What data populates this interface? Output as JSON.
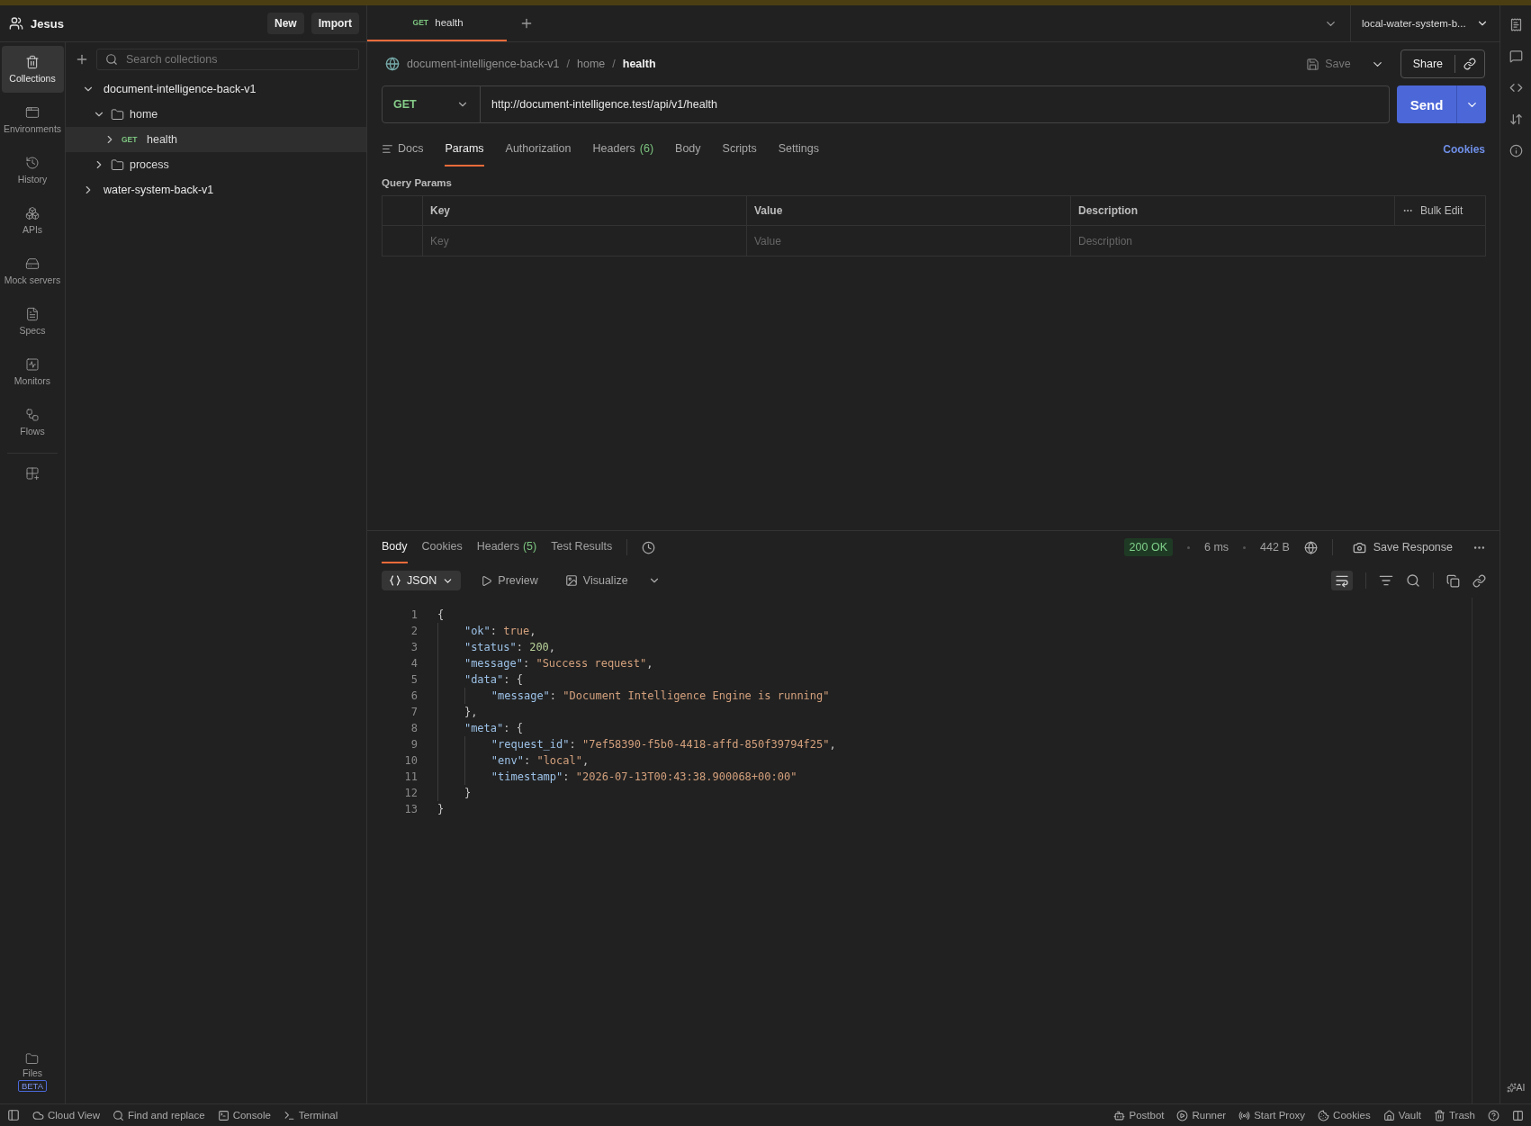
{
  "top_bar": {
    "user": "Jesus",
    "buttons": [
      "New",
      "Import"
    ]
  },
  "nav_rail": {
    "items": [
      {
        "label": "Collections",
        "selected": true
      },
      {
        "label": "Environments",
        "selected": false
      },
      {
        "label": "History",
        "selected": false
      },
      {
        "label": "APIs",
        "selected": false
      },
      {
        "label": "Mock servers",
        "selected": false
      },
      {
        "label": "Specs",
        "selected": false
      },
      {
        "label": "Monitors",
        "selected": false
      },
      {
        "label": "Flows",
        "selected": false
      }
    ],
    "files": {
      "label": "Files",
      "badge": "BETA"
    }
  },
  "sidebar": {
    "search": {
      "placeholder": "Search collections"
    },
    "tree": [
      {
        "kind": "collection",
        "label": "document-intelligence-back-v1",
        "expanded": true,
        "selected": false,
        "children": [
          {
            "kind": "folder",
            "label": "home",
            "expanded": true,
            "selected": false,
            "children": [
              {
                "kind": "request",
                "method": "GET",
                "label": "health",
                "expanded": false,
                "selected": true
              }
            ]
          },
          {
            "kind": "folder",
            "label": "process",
            "expanded": false,
            "selected": false
          }
        ]
      },
      {
        "kind": "collection",
        "label": "water-system-back-v1",
        "expanded": false,
        "selected": false
      }
    ]
  },
  "tabs": [
    {
      "method": "GET",
      "label": "health",
      "selected": true
    }
  ],
  "environment": "local-water-system-b...",
  "breadcrumb": [
    {
      "kind": "link",
      "text": "document-intelligence-back-v1"
    },
    {
      "kind": "separator",
      "text": "/"
    },
    {
      "kind": "link",
      "text": "home"
    },
    {
      "kind": "separator",
      "text": "/"
    },
    {
      "kind": "current",
      "text": "health"
    }
  ],
  "actions": {
    "save": "Save",
    "share": "Share"
  },
  "request": {
    "method": "GET",
    "url": "http://document-intelligence.test/api/v1/health",
    "send": "Send"
  },
  "request_tabs": [
    {
      "label": "Docs",
      "selected": false
    },
    {
      "label": "Params",
      "selected": true
    },
    {
      "label": "Authorization",
      "selected": false
    },
    {
      "label": "Headers",
      "count": "(6)",
      "selected": false
    },
    {
      "label": "Body",
      "selected": false
    },
    {
      "label": "Scripts",
      "selected": false
    },
    {
      "label": "Settings",
      "selected": false
    }
  ],
  "cookies_link": "Cookies",
  "query_params": {
    "title": "Query Params",
    "columns": [
      "Key",
      "Value",
      "Description"
    ],
    "bulk_edit": "Bulk Edit",
    "placeholders": [
      "Key",
      "Value",
      "Description"
    ]
  },
  "response": {
    "tabs": [
      {
        "label": "Body",
        "selected": true
      },
      {
        "label": "Cookies",
        "selected": false
      },
      {
        "label": "Headers",
        "count": "(5)",
        "selected": false
      },
      {
        "label": "Test Results",
        "selected": false
      }
    ],
    "status": "200 OK",
    "time": "6 ms",
    "size": "442 B",
    "save_response": "Save Response",
    "views": [
      {
        "label": "JSON",
        "selected": true
      },
      {
        "label": "Preview",
        "selected": false
      },
      {
        "label": "Visualize",
        "selected": false
      }
    ],
    "lines": [
      {
        "number": "1",
        "text": "{"
      },
      {
        "number": "2",
        "text": "    \"ok\": true,"
      },
      {
        "number": "3",
        "text": "    \"status\": 200,"
      },
      {
        "number": "4",
        "text": "    \"message\": \"Success request\","
      },
      {
        "number": "5",
        "text": "    \"data\": {"
      },
      {
        "number": "6",
        "text": "        \"message\": \"Document Intelligence Engine is running\""
      },
      {
        "number": "7",
        "text": "    },"
      },
      {
        "number": "8",
        "text": "    \"meta\": {"
      },
      {
        "number": "9",
        "text": "        \"request_id\": \"7ef58390-f5b0-4418-affd-850f39794f25\","
      },
      {
        "number": "10",
        "text": "        \"env\": \"local\","
      },
      {
        "number": "11",
        "text": "        \"timestamp\": \"2026-07-13T00:43:38.900068+00:00\""
      },
      {
        "number": "12",
        "text": "    }"
      },
      {
        "number": "13",
        "text": "}"
      }
    ]
  },
  "right_rail": {
    "ai": "AI"
  },
  "status_bar": {
    "left": [
      "Cloud View",
      "Find and replace",
      "Console",
      "Terminal"
    ],
    "right": [
      "Postbot",
      "Runner",
      "Start Proxy",
      "Cookies",
      "Vault",
      "Trash"
    ]
  }
}
